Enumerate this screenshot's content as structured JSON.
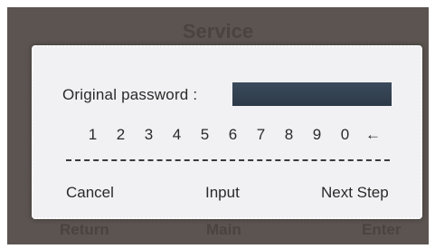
{
  "screen": {
    "title": "Service",
    "footer": {
      "return_label": "Return",
      "main_label": "Main",
      "enter_label": "Enter"
    }
  },
  "dialog": {
    "password_label": "Original password :",
    "password_value": "",
    "keypad": [
      "1",
      "2",
      "3",
      "4",
      "5",
      "6",
      "7",
      "8",
      "9",
      "0"
    ],
    "backspace_icon": "left-arrow-icon",
    "backspace_glyph": "←",
    "actions": {
      "cancel": "Cancel",
      "input": "Input",
      "next": "Next Step"
    }
  },
  "colors": {
    "screen_bg": "#5b5450",
    "dialog_bg": "#f1f1f3",
    "field_bg": "#34424f"
  }
}
